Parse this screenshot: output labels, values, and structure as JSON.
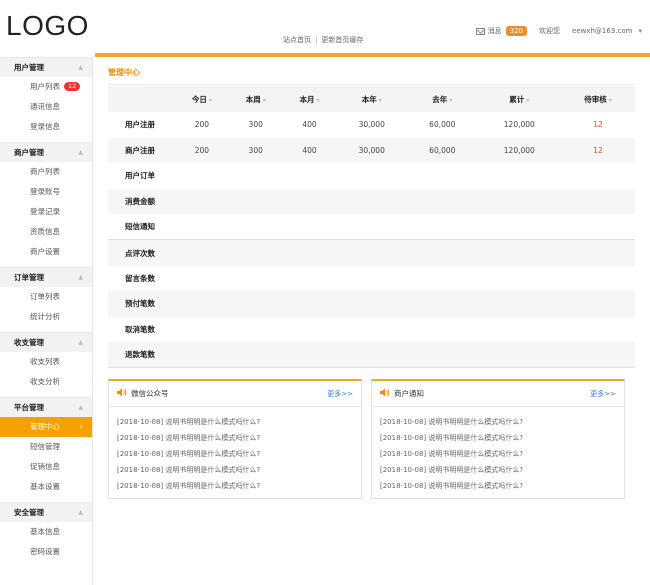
{
  "header": {
    "logo": "LOGO",
    "links": [
      "站点首页",
      "更新首页缓存"
    ],
    "messages_label": "消息",
    "messages_count": "320",
    "welcome": "欢迎您",
    "user": "eewxh@163.com"
  },
  "sidebar": {
    "groups": [
      {
        "title": "用户管理",
        "items": [
          {
            "label": "用户列表",
            "badge": "12"
          },
          {
            "label": "通讯信息"
          },
          {
            "label": "登录信息"
          }
        ]
      },
      {
        "title": "商户管理",
        "items": [
          {
            "label": "商户列表"
          },
          {
            "label": "登录账号"
          },
          {
            "label": "登录记录"
          },
          {
            "label": "资质信息"
          },
          {
            "label": "商户设置"
          }
        ]
      },
      {
        "title": "订单管理",
        "items": [
          {
            "label": "订单列表"
          },
          {
            "label": "统计分析"
          }
        ]
      },
      {
        "title": "收支管理",
        "items": [
          {
            "label": "收支列表"
          },
          {
            "label": "收支分析"
          }
        ]
      },
      {
        "title": "平台管理",
        "items": [
          {
            "label": "管理中心",
            "active": true
          },
          {
            "label": "短信管理"
          },
          {
            "label": "促销信息"
          },
          {
            "label": "基本设置"
          }
        ]
      },
      {
        "title": "安全管理",
        "items": [
          {
            "label": "基本信息"
          },
          {
            "label": "密码设置"
          }
        ]
      }
    ]
  },
  "main": {
    "title": "管理中心",
    "columns": [
      "今日",
      "本周",
      "本月",
      "本年",
      "去年",
      "累计",
      "待审核"
    ],
    "rows": [
      {
        "label": "用户注册",
        "values": [
          "200",
          "300",
          "400",
          "30,000",
          "60,000",
          "120,000",
          "12"
        ]
      },
      {
        "label": "商户注册",
        "values": [
          "200",
          "300",
          "400",
          "30,000",
          "60,000",
          "120,000",
          "12"
        ]
      },
      {
        "label": "用户订单",
        "values": [
          "",
          "",
          "",
          "",
          "",
          "",
          ""
        ]
      },
      {
        "label": "消费金额",
        "values": [
          "",
          "",
          "",
          "",
          "",
          "",
          ""
        ]
      },
      {
        "label": "短信通知",
        "values": [
          "",
          "",
          "",
          "",
          "",
          "",
          ""
        ]
      },
      {
        "label": "点评次数",
        "values": [
          "",
          "",
          "",
          "",
          "",
          "",
          ""
        ]
      },
      {
        "label": "留言条数",
        "values": [
          "",
          "",
          "",
          "",
          "",
          "",
          ""
        ]
      },
      {
        "label": "预付笔数",
        "values": [
          "",
          "",
          "",
          "",
          "",
          "",
          ""
        ]
      },
      {
        "label": "取消笔数",
        "values": [
          "",
          "",
          "",
          "",
          "",
          "",
          ""
        ]
      },
      {
        "label": "退款笔数",
        "values": [
          "",
          "",
          "",
          "",
          "",
          "",
          ""
        ]
      }
    ]
  },
  "panels": [
    {
      "title": "微信公众号",
      "more": "更多>>",
      "items": [
        "[2018-10-08] 说明书明明是什么模式吗什么?",
        "[2018-10-08] 说明书明明是什么模式吗什么?",
        "[2018-10-08] 说明书明明是什么模式吗什么?",
        "[2018-10-08] 说明书明明是什么模式吗什么?",
        "[2018-10-08] 说明书明明是什么模式吗什么?"
      ]
    },
    {
      "title": "商户通知",
      "more": "更多>>",
      "items": [
        "[2018-10-08] 说明书明明是什么模式吗什么?",
        "[2018-10-08] 说明书明明是什么模式吗什么?",
        "[2018-10-08] 说明书明明是什么模式吗什么?",
        "[2018-10-08] 说明书明明是什么模式吗什么?",
        "[2018-10-08] 说明书明明是什么模式吗什么?"
      ]
    }
  ],
  "colors": {
    "accent": "#f5a623",
    "active": "#f5a200",
    "badge": "#e33333",
    "pending": "#e0492f",
    "link": "#3a7bd5"
  },
  "icons": {
    "mail": "mail-icon",
    "speaker": "speaker-icon",
    "caret": "caret-up-icon"
  }
}
